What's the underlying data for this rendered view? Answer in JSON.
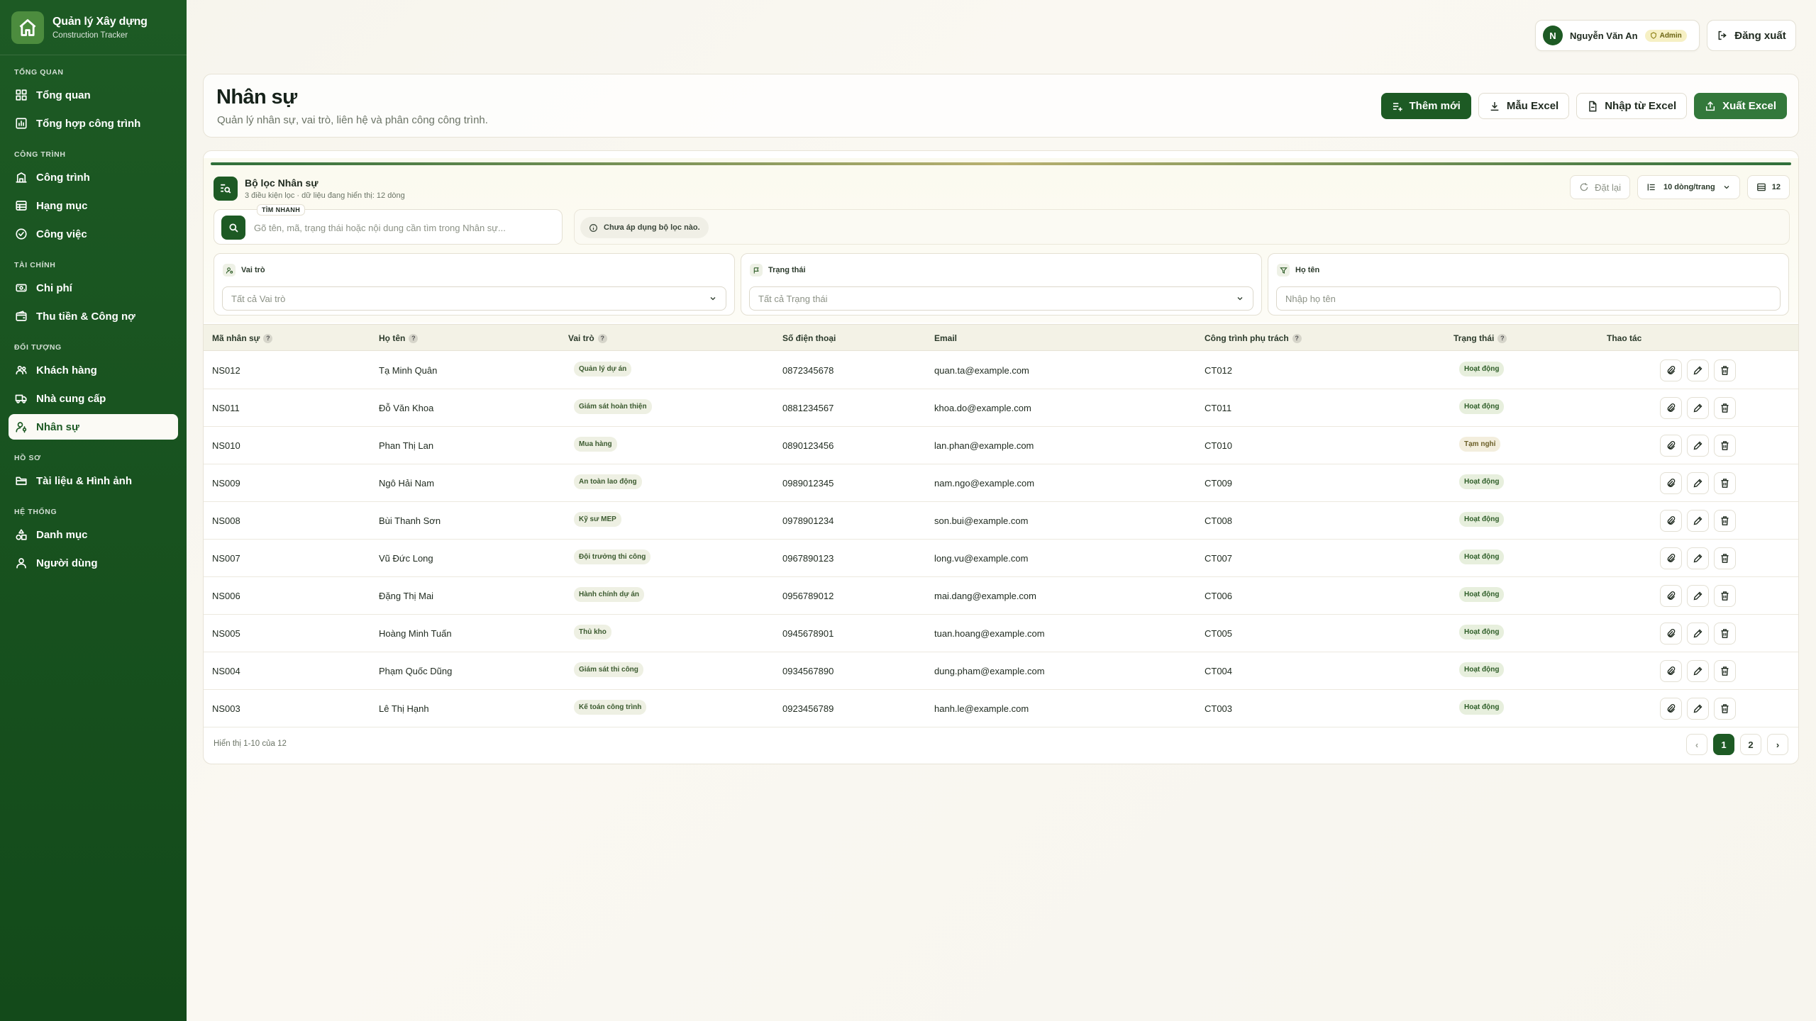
{
  "brand": {
    "title": "Quản lý Xây dựng",
    "subtitle": "Construction Tracker"
  },
  "sidebar": {
    "sections": [
      {
        "title": "TỔNG QUAN",
        "items": [
          {
            "label": "Tổng quan",
            "icon": "dashboard-icon"
          },
          {
            "label": "Tổng hợp công trình",
            "icon": "report-icon"
          }
        ]
      },
      {
        "title": "CÔNG TRÌNH",
        "items": [
          {
            "label": "Công trình",
            "icon": "building-icon"
          },
          {
            "label": "Hạng mục",
            "icon": "table-icon"
          },
          {
            "label": "Công việc",
            "icon": "check-circle-icon"
          }
        ]
      },
      {
        "title": "TÀI CHÍNH",
        "items": [
          {
            "label": "Chi phí",
            "icon": "money-icon"
          },
          {
            "label": "Thu tiền & Công nợ",
            "icon": "wallet-icon"
          }
        ]
      },
      {
        "title": "ĐỐI TƯỢNG",
        "items": [
          {
            "label": "Khách hàng",
            "icon": "users-icon"
          },
          {
            "label": "Nhà cung cấp",
            "icon": "truck-icon"
          },
          {
            "label": "Nhân sự",
            "icon": "user-cog-icon",
            "active": true
          }
        ]
      },
      {
        "title": "HỒ SƠ",
        "items": [
          {
            "label": "Tài liệu & Hình ảnh",
            "icon": "folder-icon"
          }
        ]
      },
      {
        "title": "HỆ THỐNG",
        "items": [
          {
            "label": "Danh mục",
            "icon": "shapes-icon"
          },
          {
            "label": "Người dùng",
            "icon": "user-icon"
          }
        ]
      }
    ]
  },
  "header": {
    "avatar_initial": "N",
    "user_name": "Nguyễn Văn An",
    "role": "Admin",
    "logout_label": "Đăng xuất"
  },
  "page": {
    "title": "Nhân sự",
    "subtitle": "Quản lý nhân sự, vai trò, liên hệ và phân công công trình."
  },
  "actions": {
    "add_label": "Thêm mới",
    "template_label": "Mẫu Excel",
    "import_label": "Nhập từ Excel",
    "export_label": "Xuất Excel"
  },
  "filter": {
    "title": "Bộ lọc Nhân sự",
    "subtitle": "3 điều kiện lọc · dữ liệu đang hiển thị: 12 dòng",
    "reset_label": "Đặt lại",
    "page_size_label": "10 dòng/trang",
    "count": "12",
    "quick_tag": "TÌM NHANH",
    "search_placeholder": "Gõ tên, mã, trạng thái hoặc nội dung cần tìm trong Nhân sự...",
    "notice": "Chưa áp dụng bộ lọc nào.",
    "role_label": "Vai trò",
    "role_value": "Tất cả Vai trò",
    "status_label": "Trạng thái",
    "status_value": "Tất cả Trạng thái",
    "name_label": "Họ tên",
    "name_placeholder": "Nhập họ tên"
  },
  "table": {
    "columns": [
      "Mã nhân sự",
      "Họ tên",
      "Vai trò",
      "Số điện thoại",
      "Email",
      "Công trình phụ trách",
      "Trạng thái",
      "Thao tác"
    ],
    "rows": [
      {
        "code": "NS012",
        "name": "Tạ Minh Quân",
        "role": "Quản lý dự án",
        "phone": "0872345678",
        "email": "quan.ta@example.com",
        "project": "CT012",
        "status": "Hoạt động"
      },
      {
        "code": "NS011",
        "name": "Đỗ Văn Khoa",
        "role": "Giám sát hoàn thiện",
        "phone": "0881234567",
        "email": "khoa.do@example.com",
        "project": "CT011",
        "status": "Hoạt động"
      },
      {
        "code": "NS010",
        "name": "Phan Thị Lan",
        "role": "Mua hàng",
        "phone": "0890123456",
        "email": "lan.phan@example.com",
        "project": "CT010",
        "status": "Tạm nghỉ"
      },
      {
        "code": "NS009",
        "name": "Ngô Hải Nam",
        "role": "An toàn lao động",
        "phone": "0989012345",
        "email": "nam.ngo@example.com",
        "project": "CT009",
        "status": "Hoạt động"
      },
      {
        "code": "NS008",
        "name": "Bùi Thanh Sơn",
        "role": "Kỹ sư MEP",
        "phone": "0978901234",
        "email": "son.bui@example.com",
        "project": "CT008",
        "status": "Hoạt động"
      },
      {
        "code": "NS007",
        "name": "Vũ Đức Long",
        "role": "Đội trưởng thi công",
        "phone": "0967890123",
        "email": "long.vu@example.com",
        "project": "CT007",
        "status": "Hoạt động"
      },
      {
        "code": "NS006",
        "name": "Đặng Thị Mai",
        "role": "Hành chính dự án",
        "phone": "0956789012",
        "email": "mai.dang@example.com",
        "project": "CT006",
        "status": "Hoạt động"
      },
      {
        "code": "NS005",
        "name": "Hoàng Minh Tuấn",
        "role": "Thủ kho",
        "phone": "0945678901",
        "email": "tuan.hoang@example.com",
        "project": "CT005",
        "status": "Hoạt động"
      },
      {
        "code": "NS004",
        "name": "Phạm Quốc Dũng",
        "role": "Giám sát thi công",
        "phone": "0934567890",
        "email": "dung.pham@example.com",
        "project": "CT004",
        "status": "Hoạt động"
      },
      {
        "code": "NS003",
        "name": "Lê Thị Hạnh",
        "role": "Kế toán công trình",
        "phone": "0923456789",
        "email": "hanh.le@example.com",
        "project": "CT003",
        "status": "Hoạt động"
      }
    ]
  },
  "footer": {
    "info": "Hiển thị 1-10 của 12",
    "prev": "‹",
    "pages": [
      "1",
      "2"
    ],
    "next": "›"
  }
}
